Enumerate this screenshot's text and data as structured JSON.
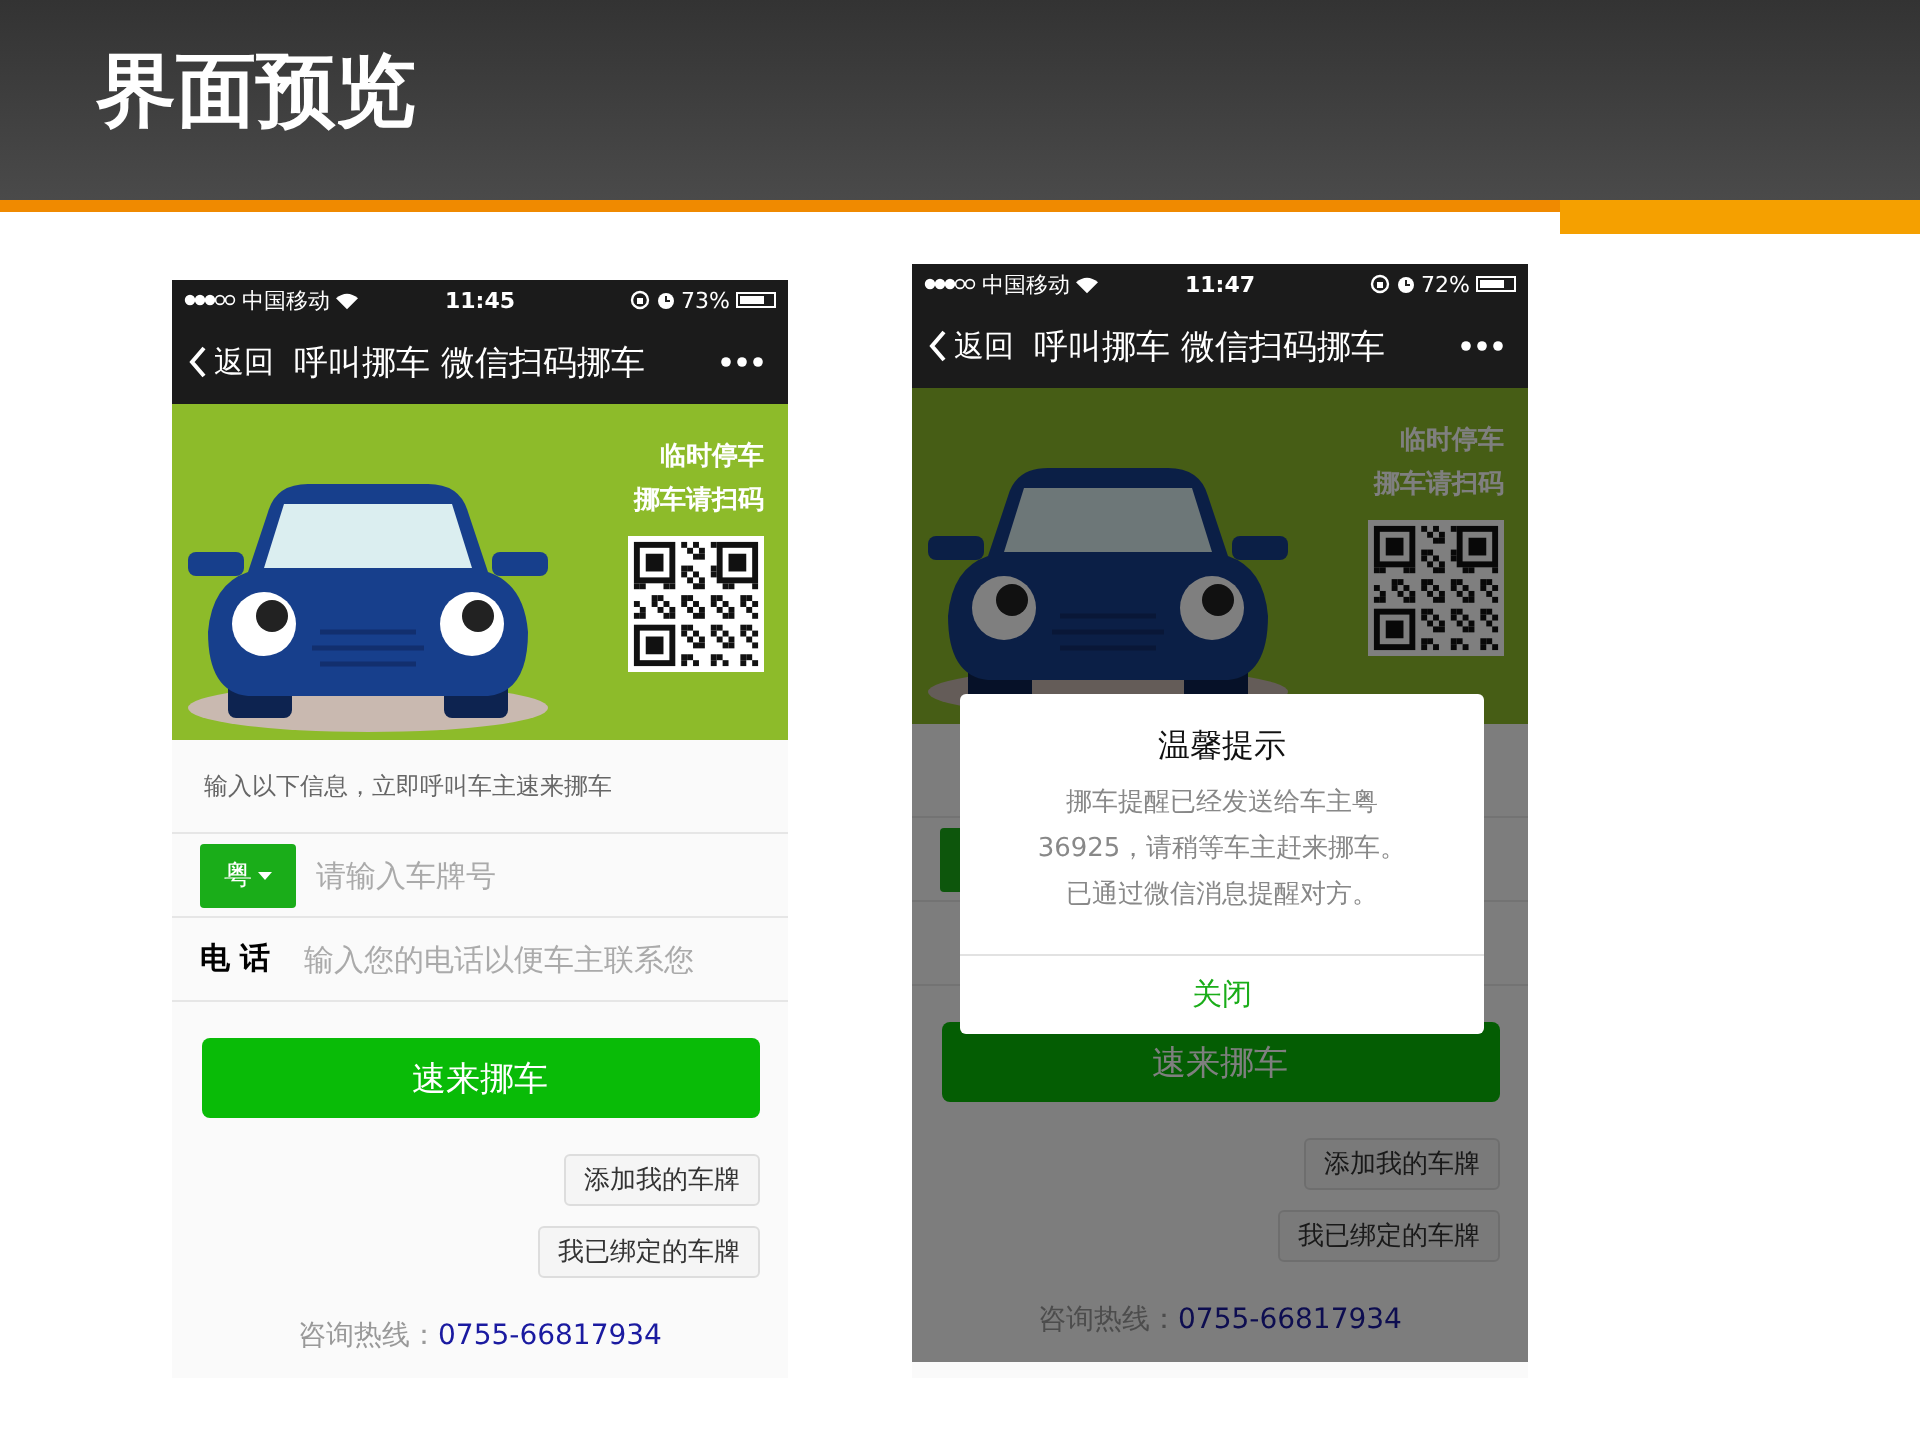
{
  "slide": {
    "title": "界面预览"
  },
  "phones": [
    {
      "status": {
        "carrier": "中国移动",
        "time": "11:45",
        "battery": "73%"
      },
      "nav": {
        "back": "返回",
        "title": "呼叫挪车 微信扫码挪车"
      },
      "banner": {
        "line1": "临时停车",
        "line2": "挪车请扫码"
      },
      "form": {
        "hint": "输入以下信息，立即呼叫车主速来挪车",
        "province": "粤",
        "plate_placeholder": "请输入车牌号",
        "phone_label": "电 话",
        "phone_placeholder": "输入您的电话以便车主联系您"
      },
      "submit": "速来挪车",
      "links": [
        "添加我的车牌",
        "我已绑定的车牌"
      ],
      "hotline_label": "咨询热线：",
      "hotline": "0755-66817934"
    },
    {
      "status": {
        "carrier": "中国移动",
        "time": "11:47",
        "battery": "72%"
      },
      "nav": {
        "back": "返回",
        "title": "呼叫挪车 微信扫码挪车"
      },
      "banner": {
        "line1": "临时停车",
        "line2": "挪车请扫码"
      },
      "submit": "速来挪车",
      "links": [
        "添加我的车牌",
        "我已绑定的车牌"
      ],
      "hotline_label": "咨询热线：",
      "hotline": "0755-66817934",
      "dialog": {
        "title": "温馨提示",
        "message_lines": [
          "挪车提醒已经发送给车主粤",
          "36925，请稍等车主赶来挪车。",
          "已通过微信消息提醒对方。"
        ],
        "button": "关闭"
      }
    }
  ]
}
